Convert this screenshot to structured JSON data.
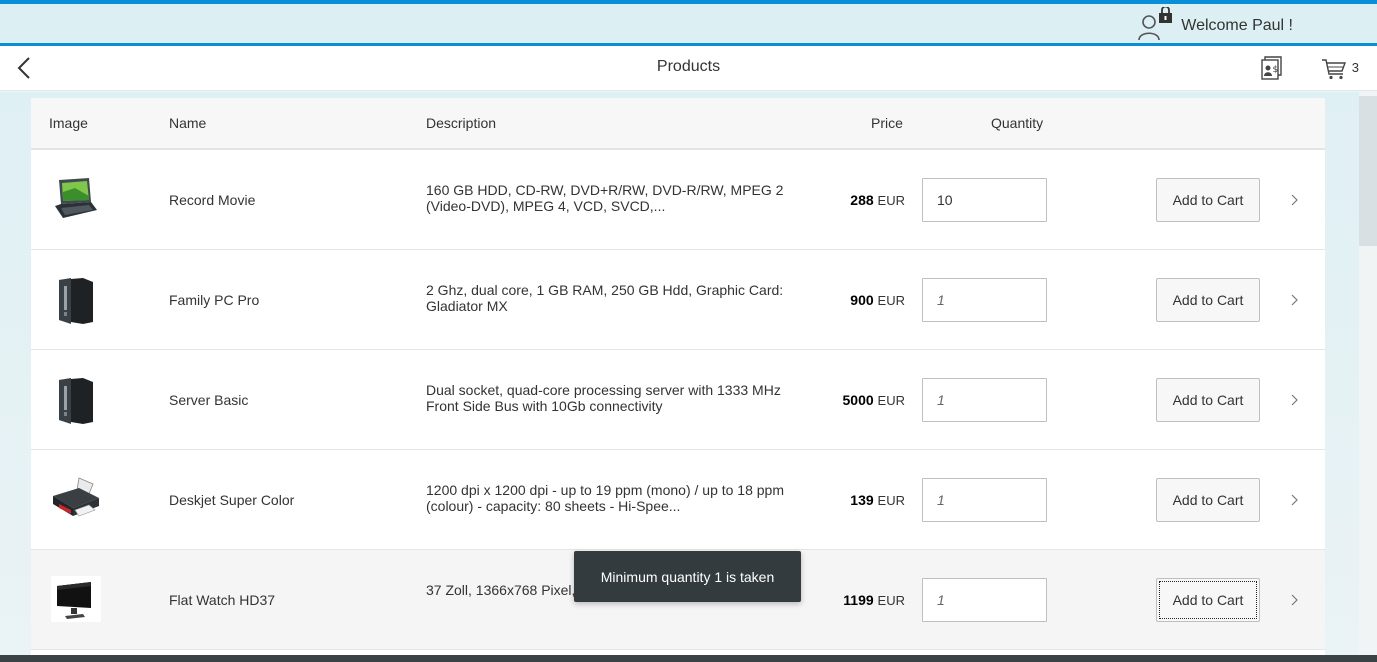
{
  "user": {
    "welcome_text": "Welcome Paul !"
  },
  "header": {
    "title": "Products",
    "cart_count": "3"
  },
  "table": {
    "columns": {
      "image": "Image",
      "name": "Name",
      "description": "Description",
      "price": "Price",
      "quantity": "Quantity"
    },
    "rows": [
      {
        "name": "Record Movie",
        "description": "160 GB HDD, CD-RW, DVD+R/RW, DVD-R/RW, MPEG 2 (Video-DVD), MPEG 4, VCD, SVCD,...",
        "price": "288",
        "currency": "EUR",
        "quantity_value": "10",
        "quantity_placeholder": "1",
        "button_label": "Add to Cart",
        "image_icon": "laptop-icon"
      },
      {
        "name": "Family PC Pro",
        "description": "2 Ghz, dual core, 1 GB RAM, 250 GB Hdd, Graphic Card: Gladiator MX",
        "price": "900",
        "currency": "EUR",
        "quantity_value": "",
        "quantity_placeholder": "1",
        "button_label": "Add to Cart",
        "image_icon": "pc-tower-icon"
      },
      {
        "name": "Server Basic",
        "description": "Dual socket, quad-core processing server with 1333 MHz Front Side Bus with 10Gb connectivity",
        "price": "5000",
        "currency": "EUR",
        "quantity_value": "",
        "quantity_placeholder": "1",
        "button_label": "Add to Cart",
        "image_icon": "server-tower-icon"
      },
      {
        "name": "Deskjet Super Color",
        "description": "1200 dpi x 1200 dpi - up to 19 ppm (mono) / up to 18 ppm (colour) - capacity: 80 sheets - Hi-Spee...",
        "price": "139",
        "currency": "EUR",
        "quantity_value": "",
        "quantity_placeholder": "1",
        "button_label": "Add to Cart",
        "image_icon": "printer-icon"
      },
      {
        "name": "Flat Watch HD37",
        "description": "37 Zoll, 1366x768 Pixel, 16:9, HDTV ready",
        "price": "1199",
        "currency": "EUR",
        "quantity_value": "",
        "quantity_placeholder": "1",
        "button_label": "Add to Cart",
        "image_icon": "monitor-icon"
      }
    ]
  },
  "toast": {
    "message": "Minimum quantity 1 is taken"
  }
}
